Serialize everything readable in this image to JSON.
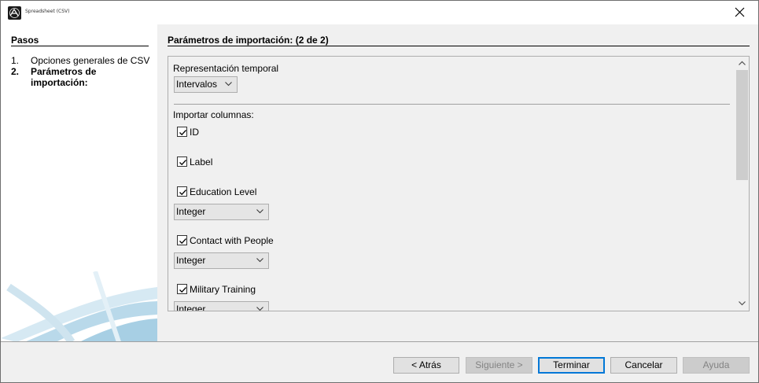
{
  "window": {
    "title": "Spreadsheet (CSV)"
  },
  "steps": {
    "title": "Pasos",
    "items": [
      {
        "num": "1.",
        "label": "Opciones generales de CSV"
      },
      {
        "num": "2.",
        "label": "Parámetros de importación:"
      }
    ]
  },
  "main": {
    "title": "Parámetros de importación: (2 de 2)",
    "time_representation_label": "Representación temporal",
    "time_representation_value": "Intervalos",
    "import_columns_label": "Importar columnas:",
    "columns": [
      {
        "name": "ID",
        "checked": true,
        "type": null
      },
      {
        "name": "Label",
        "checked": true,
        "type": null
      },
      {
        "name": "Education Level",
        "checked": true,
        "type": "Integer"
      },
      {
        "name": "Contact with People",
        "checked": true,
        "type": "Integer"
      },
      {
        "name": "Military Training",
        "checked": true,
        "type": "Integer"
      }
    ]
  },
  "footer": {
    "back": "< Atrás",
    "next": "Siguiente >",
    "finish": "Terminar",
    "cancel": "Cancelar",
    "help": "Ayuda"
  },
  "colors": {
    "accent": "#0078d7",
    "art_blue": "#b9d9ea"
  }
}
